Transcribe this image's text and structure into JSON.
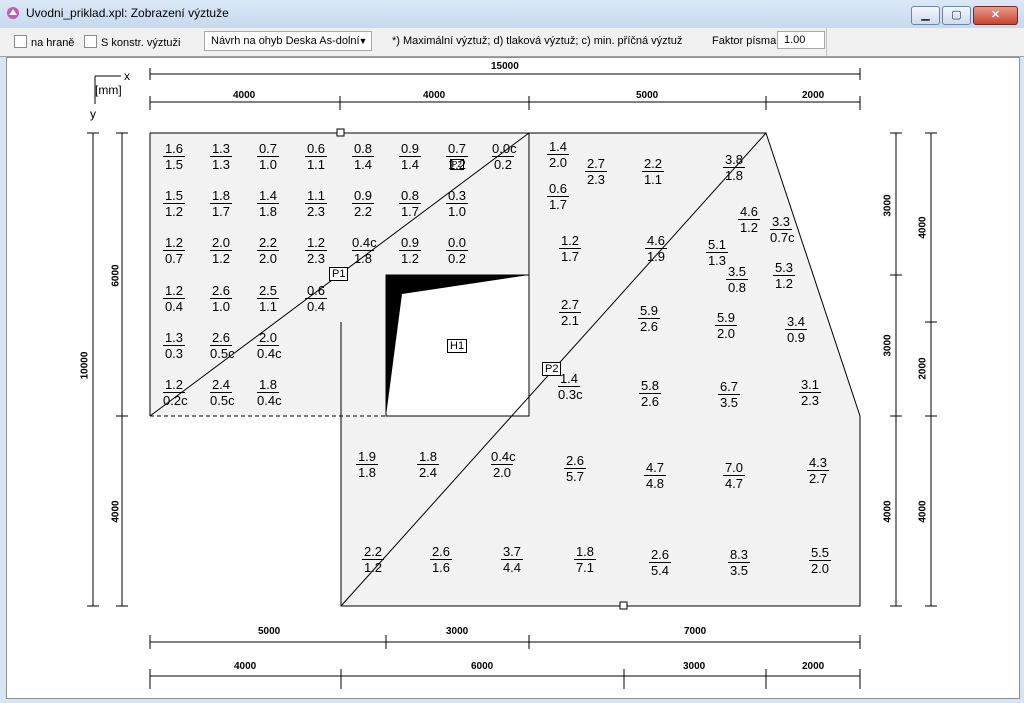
{
  "window": {
    "title": "Uvodni_priklad.xpl: Zobrazení výztuže"
  },
  "toolbar": {
    "na_hrane": "na hraně",
    "s_konstr": "S konstr. výztuži",
    "select_value": "Návrh na ohyb Deska As-dolní",
    "legend": "*) Maximální výztuž;   d) tlaková výztuž;   c) min. příčná výztuž",
    "faktor_label": "Faktor písma",
    "faktor_value": "1.00"
  },
  "drawing": {
    "axis_x": "x",
    "axis_y": "y",
    "units": "[mm]",
    "top_dims": {
      "total": "15000",
      "d1": "4000",
      "d2": "4000",
      "d3": "5000",
      "d4": "2000"
    },
    "bottom_dims1": {
      "d1": "5000",
      "d2": "3000",
      "d3": "7000"
    },
    "bottom_dims2": {
      "d1": "4000",
      "d2": "6000",
      "d3": "3000",
      "d4": "2000"
    },
    "left_dims": {
      "total": "10000",
      "d1": "6000",
      "d2": "4000"
    },
    "right_dims1": {
      "d1": "3000",
      "d2": "3000",
      "d3": "4000"
    },
    "right_dims2": {
      "d1": "4000",
      "d2": "2000",
      "d3": "4000"
    },
    "labels": {
      "p1": "P1",
      "p2": "P2",
      "h1": "H1",
      "p2small": "P2"
    },
    "values": [
      [
        "1.6",
        "1.5"
      ],
      [
        "1.3",
        "1.3"
      ],
      [
        "0.7",
        "1.0"
      ],
      [
        "0.6",
        "1.1"
      ],
      [
        "0.8",
        "1.4"
      ],
      [
        "0.9",
        "1.4"
      ],
      [
        "0.7",
        "1.2"
      ],
      [
        "0.0c",
        "0.2"
      ],
      [
        "1.5",
        "1.2"
      ],
      [
        "1.8",
        "1.7"
      ],
      [
        "1.4",
        "1.8"
      ],
      [
        "1.1",
        "2.3"
      ],
      [
        "0.9",
        "2.2"
      ],
      [
        "0.8",
        "1.7"
      ],
      [
        "0.3",
        "1.0"
      ],
      [
        "1.2",
        "0.7"
      ],
      [
        "2.0",
        "1.2"
      ],
      [
        "2.2",
        "2.0"
      ],
      [
        "1.2",
        "2.3"
      ],
      [
        "0.4c",
        "1.8"
      ],
      [
        "0.9",
        "1.2"
      ],
      [
        "0.0",
        "0.2"
      ],
      [
        "1.2",
        "0.4"
      ],
      [
        "2.6",
        "1.0"
      ],
      [
        "2.5",
        "1.1"
      ],
      [
        "0.6",
        "0.4"
      ],
      [
        "1.3",
        "0.3"
      ],
      [
        "2.6",
        "0.5c"
      ],
      [
        "2.0",
        "0.4c"
      ],
      [
        "1.2",
        "0.2c"
      ],
      [
        "2.4",
        "0.5c"
      ],
      [
        "1.8",
        "0.4c"
      ],
      [
        "1.4",
        "2.0"
      ],
      [
        "2.7",
        "2.3"
      ],
      [
        "2.2",
        "1.1"
      ],
      [
        "3.8",
        "1.8"
      ],
      [
        "0.6",
        "1.7"
      ],
      [
        "4.6",
        "1.2"
      ],
      [
        "3.3",
        "0.7c"
      ],
      [
        "1.2",
        "1.7"
      ],
      [
        "4.6",
        "1.9"
      ],
      [
        "5.1",
        "1.3"
      ],
      [
        "3.5",
        "0.8"
      ],
      [
        "5.3",
        "1.2"
      ],
      [
        "2.7",
        "2.1"
      ],
      [
        "5.9",
        "2.6"
      ],
      [
        "5.9",
        "2.0"
      ],
      [
        "3.4",
        "0.9"
      ],
      [
        "1.4",
        "0.3c"
      ],
      [
        "5.8",
        "2.6"
      ],
      [
        "6.7",
        "3.5"
      ],
      [
        "3.1",
        "2.3"
      ],
      [
        "1.9",
        "1.8"
      ],
      [
        "1.8",
        "2.4"
      ],
      [
        "0.4c",
        "2.0"
      ],
      [
        "2.6",
        "5.7"
      ],
      [
        "4.7",
        "4.8"
      ],
      [
        "7.0",
        "4.7"
      ],
      [
        "4.3",
        "2.7"
      ],
      [
        "2.2",
        "1.2"
      ],
      [
        "2.6",
        "1.6"
      ],
      [
        "3.7",
        "4.4"
      ],
      [
        "1.8",
        "7.1"
      ],
      [
        "2.6",
        "5.4"
      ],
      [
        "8.3",
        "3.5"
      ],
      [
        "5.5",
        "2.0"
      ]
    ]
  }
}
